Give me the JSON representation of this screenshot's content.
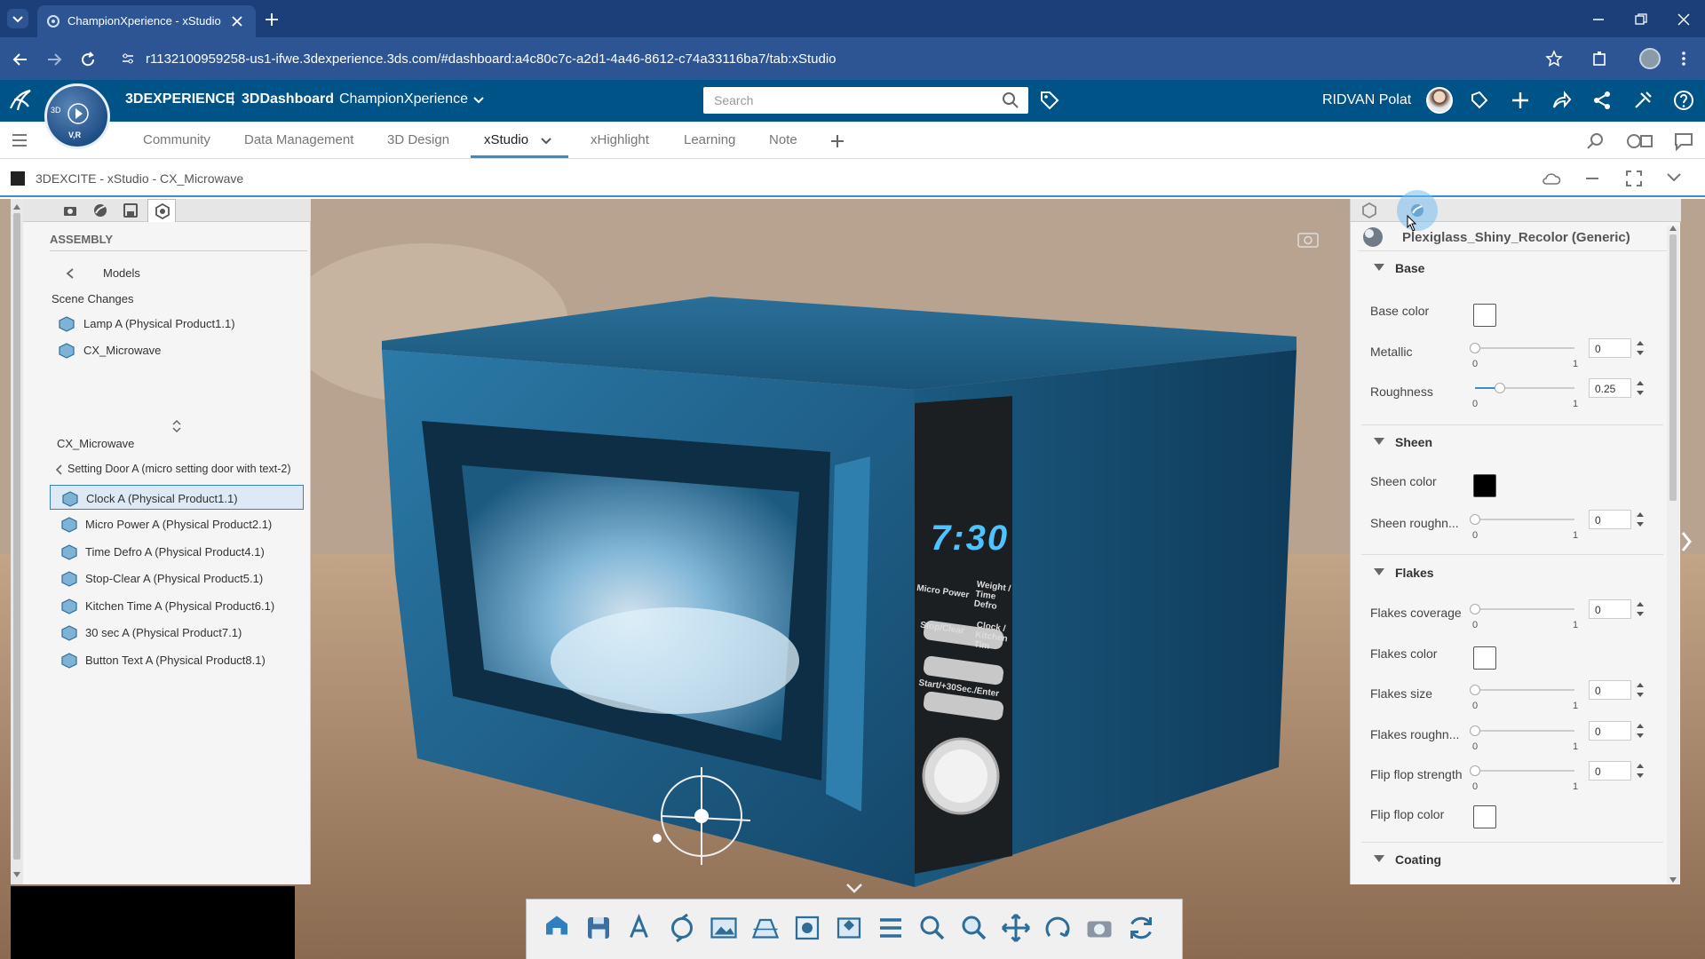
{
  "browser": {
    "tab_title": "ChampionXperience - xStudio",
    "url": "r1132100959258-us1-ifwe.3dexperience.3ds.com/#dashboard:a4c80c7c-a2d1-4a46-8612-c74a33116ba7/tab:xStudio"
  },
  "header": {
    "brand": "3DEXPERIENCE",
    "separator": "|",
    "dashboard": "3DDashboard",
    "space": "ChampionXperience",
    "search_placeholder": "Search",
    "user": "RIDVAN Polat",
    "compass_label": "V,R",
    "compass_small": "3D"
  },
  "tabs": [
    {
      "label": "Community"
    },
    {
      "label": "Data Management"
    },
    {
      "label": "3D Design"
    },
    {
      "label": "xStudio"
    },
    {
      "label": "xHighlight"
    },
    {
      "label": "Learning"
    },
    {
      "label": "Note"
    }
  ],
  "app": {
    "title": "3DEXCITE - xStudio - CX_Microwave"
  },
  "left_panel": {
    "section": "ASSEMBLY",
    "back_label": "Models",
    "scene_changes": "Scene Changes",
    "scene_items": [
      {
        "label": "Lamp A (Physical Product1.1)"
      },
      {
        "label": "CX_Microwave"
      }
    ],
    "model_title": "CX_Microwave",
    "breadcrumb": "Setting Door A (micro setting door with text-2)",
    "parts": [
      {
        "label": "Clock A (Physical Product1.1)"
      },
      {
        "label": "Micro Power A (Physical Product2.1)"
      },
      {
        "label": "Time Defro A (Physical Product4.1)"
      },
      {
        "label": "Stop-Clear A (Physical Product5.1)"
      },
      {
        "label": "Kitchen Time A (Physical Product6.1)"
      },
      {
        "label": "30 sec A (Physical Product7.1)"
      },
      {
        "label": "Button Text A (Physical Product8.1)"
      }
    ]
  },
  "right_panel": {
    "material": "Plexiglass_Shiny_Recolor (Generic)",
    "sections": {
      "base": "Base",
      "sheen": "Sheen",
      "flakes": "Flakes",
      "coating": "Coating"
    },
    "props": {
      "base_color": {
        "label": "Base color",
        "color": "#ffffff"
      },
      "metallic": {
        "label": "Metallic",
        "value": "0",
        "fraction": 0,
        "min": "0",
        "max": "1"
      },
      "roughness": {
        "label": "Roughness",
        "value": "0.25",
        "fraction": 0.25,
        "min": "0",
        "max": "1"
      },
      "sheen_color": {
        "label": "Sheen color",
        "color": "#000000"
      },
      "sheen_roughness": {
        "label": "Sheen roughn...",
        "value": "0",
        "fraction": 0,
        "min": "0",
        "max": "1"
      },
      "flakes_coverage": {
        "label": "Flakes coverage",
        "value": "0",
        "fraction": 0,
        "min": "0",
        "max": "1"
      },
      "flakes_color": {
        "label": "Flakes color",
        "color": "#ffffff"
      },
      "flakes_size": {
        "label": "Flakes size",
        "value": "0",
        "fraction": 0,
        "min": "0",
        "max": "1"
      },
      "flakes_roughness": {
        "label": "Flakes roughn...",
        "value": "0",
        "fraction": 0,
        "min": "0",
        "max": "1"
      },
      "flip_flop_strength": {
        "label": "Flip flop strength",
        "value": "0",
        "fraction": 0,
        "min": "0",
        "max": "1"
      },
      "flip_flop_color": {
        "label": "Flip flop color",
        "color": "#ffffff"
      }
    }
  },
  "scene": {
    "display_time": "7:30",
    "button_labels": [
      "Micro Power",
      "Weight / Time Defro",
      "Stop/Clear",
      "Clock / Kitchen Tim",
      "Start/+30Sec./Enter"
    ]
  },
  "toolbar_icons": [
    "home-icon",
    "save-icon",
    "text-style-icon",
    "rotate-icon",
    "image-icon",
    "environment-icon",
    "viewpoint-icon",
    "render-icon",
    "list-icon",
    "zoom-icon",
    "zoom-area-icon",
    "pan-icon",
    "rotate-view-icon",
    "camera-icon",
    "cycle-icon"
  ],
  "colors": {
    "browser_dark": "#1b3f78",
    "browser_light": "#2d5594",
    "header_blue": "#005386",
    "accent": "#368ec4",
    "microwave_blue": "#1d6a93"
  }
}
